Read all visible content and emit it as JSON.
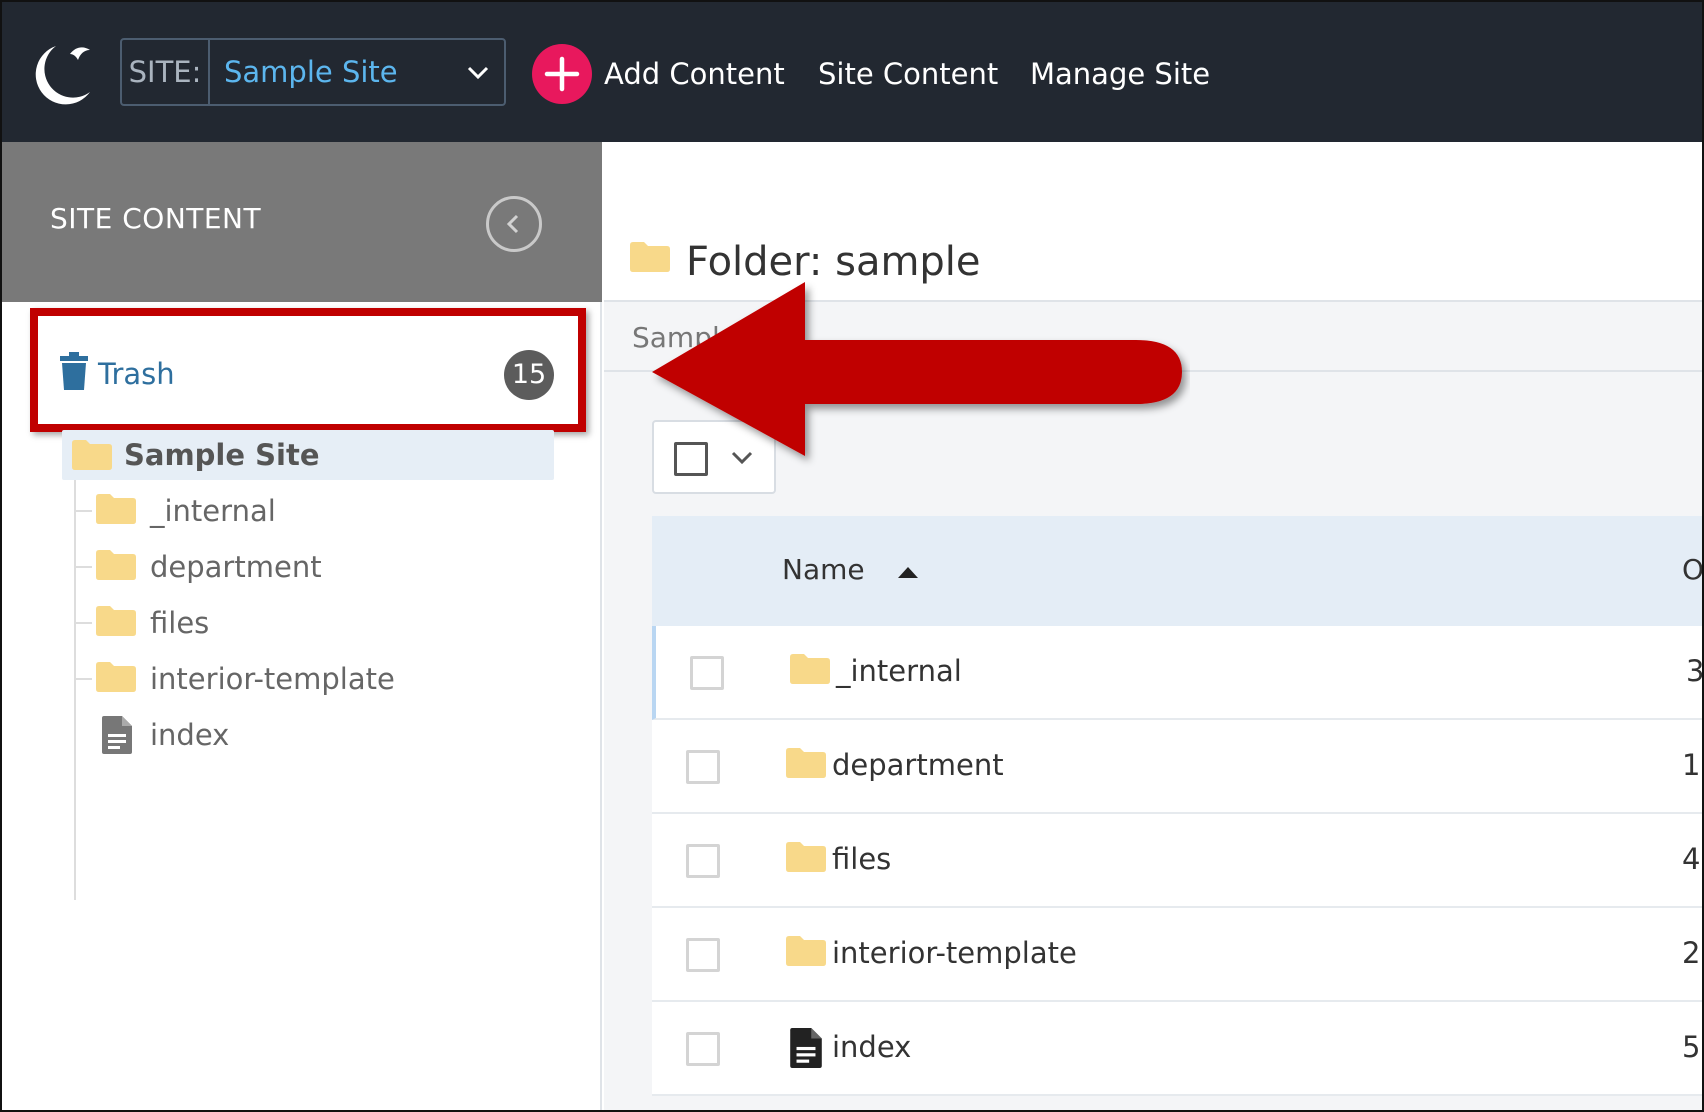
{
  "app": {
    "logo_icon": "crescent-bird-logo-icon",
    "site_prefix": "SITE:",
    "site_name": "Sample Site",
    "nav": {
      "add_content": "Add Content",
      "site_content": "Site Content",
      "manage_site": "Manage Site"
    }
  },
  "sidebar": {
    "title": "SITE CONTENT",
    "trash": {
      "label": "Trash",
      "count": "15"
    },
    "root": {
      "label": "Sample Site"
    },
    "items": [
      {
        "label": "_internal",
        "icon": "folder-icon"
      },
      {
        "label": "department",
        "icon": "folder-icon"
      },
      {
        "label": "files",
        "icon": "folder-icon"
      },
      {
        "label": "interior-template",
        "icon": "folder-icon"
      },
      {
        "label": "index",
        "icon": "page-icon"
      }
    ]
  },
  "main": {
    "title": "Folder: sample",
    "breadcrumb": "Sampl",
    "table": {
      "columns": [
        "Name",
        "Or"
      ],
      "rows": [
        {
          "name": "_internal",
          "icon": "folder-icon",
          "count": "3"
        },
        {
          "name": "department",
          "icon": "folder-icon",
          "count": "1"
        },
        {
          "name": "files",
          "icon": "folder-icon",
          "count": "4"
        },
        {
          "name": "interior-template",
          "icon": "folder-icon",
          "count": "2"
        },
        {
          "name": "index",
          "icon": "page-icon",
          "count": "5"
        }
      ]
    }
  },
  "colors": {
    "topbar": "#222831",
    "accent_pink": "#e8185d",
    "site_link": "#5cb6ee",
    "folder": "#f8d98a",
    "annotation_red": "#c00000"
  }
}
